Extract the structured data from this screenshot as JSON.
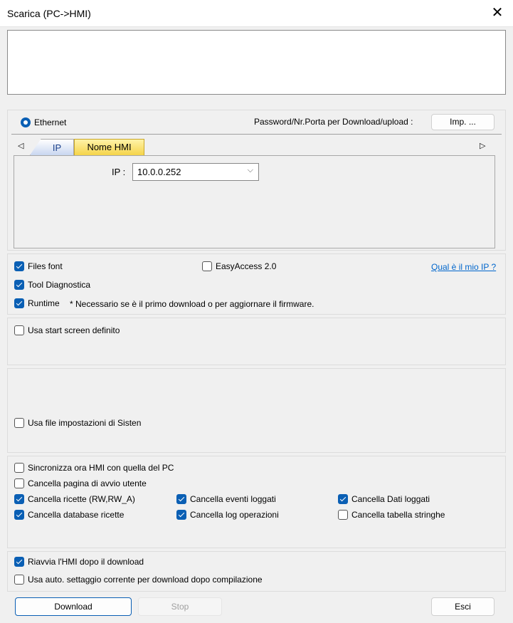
{
  "window": {
    "title": "Scarica (PC->HMI)",
    "close": "✕"
  },
  "connection": {
    "ethernet_label": "Ethernet",
    "password_label": "Password/Nr.Porta per Download/upload :",
    "imp_button": "Imp. ..."
  },
  "tabs": [
    {
      "label": "IP",
      "active": true
    },
    {
      "label": "Nome HMI",
      "active": false
    }
  ],
  "ip": {
    "label": "IP :",
    "value": "10.0.0.252"
  },
  "options": {
    "files_font": {
      "label": "Files font",
      "checked": true
    },
    "easyaccess": {
      "label": "EasyAccess 2.0",
      "checked": false
    },
    "my_ip_link": "Qual è il mio IP ?",
    "tool_diag": {
      "label": "Tool Diagnostica",
      "checked": true
    },
    "runtime": {
      "label": "Runtime",
      "checked": true
    },
    "runtime_note": "* Necessario se è il primo download o per aggiornare il firmware."
  },
  "start_screen": {
    "label": "Usa start screen definito",
    "checked": false
  },
  "system_file": {
    "label": "Usa file impostazioni di Sisten",
    "checked": false
  },
  "clear": {
    "sync": {
      "label": "Sincronizza ora HMI con quella del PC",
      "checked": false
    },
    "startpage": {
      "label": "Cancella pagina di avvio utente",
      "checked": false
    },
    "recipes": {
      "label": "Cancella ricette (RW,RW_A)",
      "checked": true
    },
    "events": {
      "label": "Cancella eventi loggati",
      "checked": true
    },
    "data": {
      "label": "Cancella Dati loggati",
      "checked": true
    },
    "recipe_db": {
      "label": "Cancella database ricette",
      "checked": true
    },
    "oplog": {
      "label": "Cancella log operazioni",
      "checked": true
    },
    "strings": {
      "label": "Cancella tabella stringhe",
      "checked": false
    }
  },
  "after": {
    "restart": {
      "label": "Riavvia l'HMI dopo il download",
      "checked": true
    },
    "auto": {
      "label": "Usa auto. settaggio corrente per download dopo compilazione",
      "checked": false
    }
  },
  "buttons": {
    "download": "Download",
    "stop": "Stop",
    "exit": "Esci"
  }
}
